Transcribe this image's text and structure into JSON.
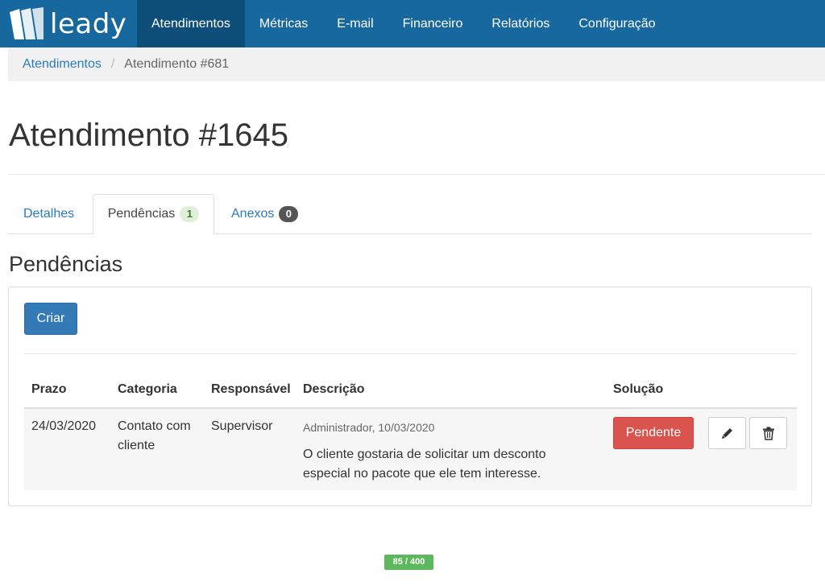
{
  "app": {
    "brand": "leady",
    "accent_color": "#16689f"
  },
  "nav": {
    "items": [
      {
        "label": "Atendimentos",
        "active": true
      },
      {
        "label": "Métricas",
        "active": false
      },
      {
        "label": "E-mail",
        "active": false
      },
      {
        "label": "Financeiro",
        "active": false
      },
      {
        "label": "Relatórios",
        "active": false
      },
      {
        "label": "Configuração",
        "active": false
      }
    ]
  },
  "breadcrumb": {
    "link": "Atendimentos",
    "separator": "/",
    "current": "Atendimento #681"
  },
  "page": {
    "title": "Atendimento #1645"
  },
  "tabs": [
    {
      "label": "Detalhes"
    },
    {
      "label": "Pendências",
      "badge": "1",
      "active": true
    },
    {
      "label": "Anexos",
      "badge": "0"
    }
  ],
  "section": {
    "title": "Pendências",
    "create_label": "Criar"
  },
  "table": {
    "headers": {
      "prazo": "Prazo",
      "categoria": "Categoria",
      "responsavel": "Responsável",
      "descricao": "Descrição",
      "solucao": "Solução"
    },
    "rows": [
      {
        "prazo": "24/03/2020",
        "categoria_line1": "Contato com",
        "categoria_line2": "cliente",
        "responsavel": "Supervisor",
        "meta": "Administrador, 10/03/2020",
        "descricao_line1": "O cliente gostaria de solicitar um desconto",
        "descricao_line2": "especial no pacote que ele tem interesse.",
        "status": "Pendente",
        "edit_icon": "pencil-icon",
        "delete_icon": "trash-icon"
      }
    ]
  },
  "footer": {
    "counter": "85 / 400"
  }
}
